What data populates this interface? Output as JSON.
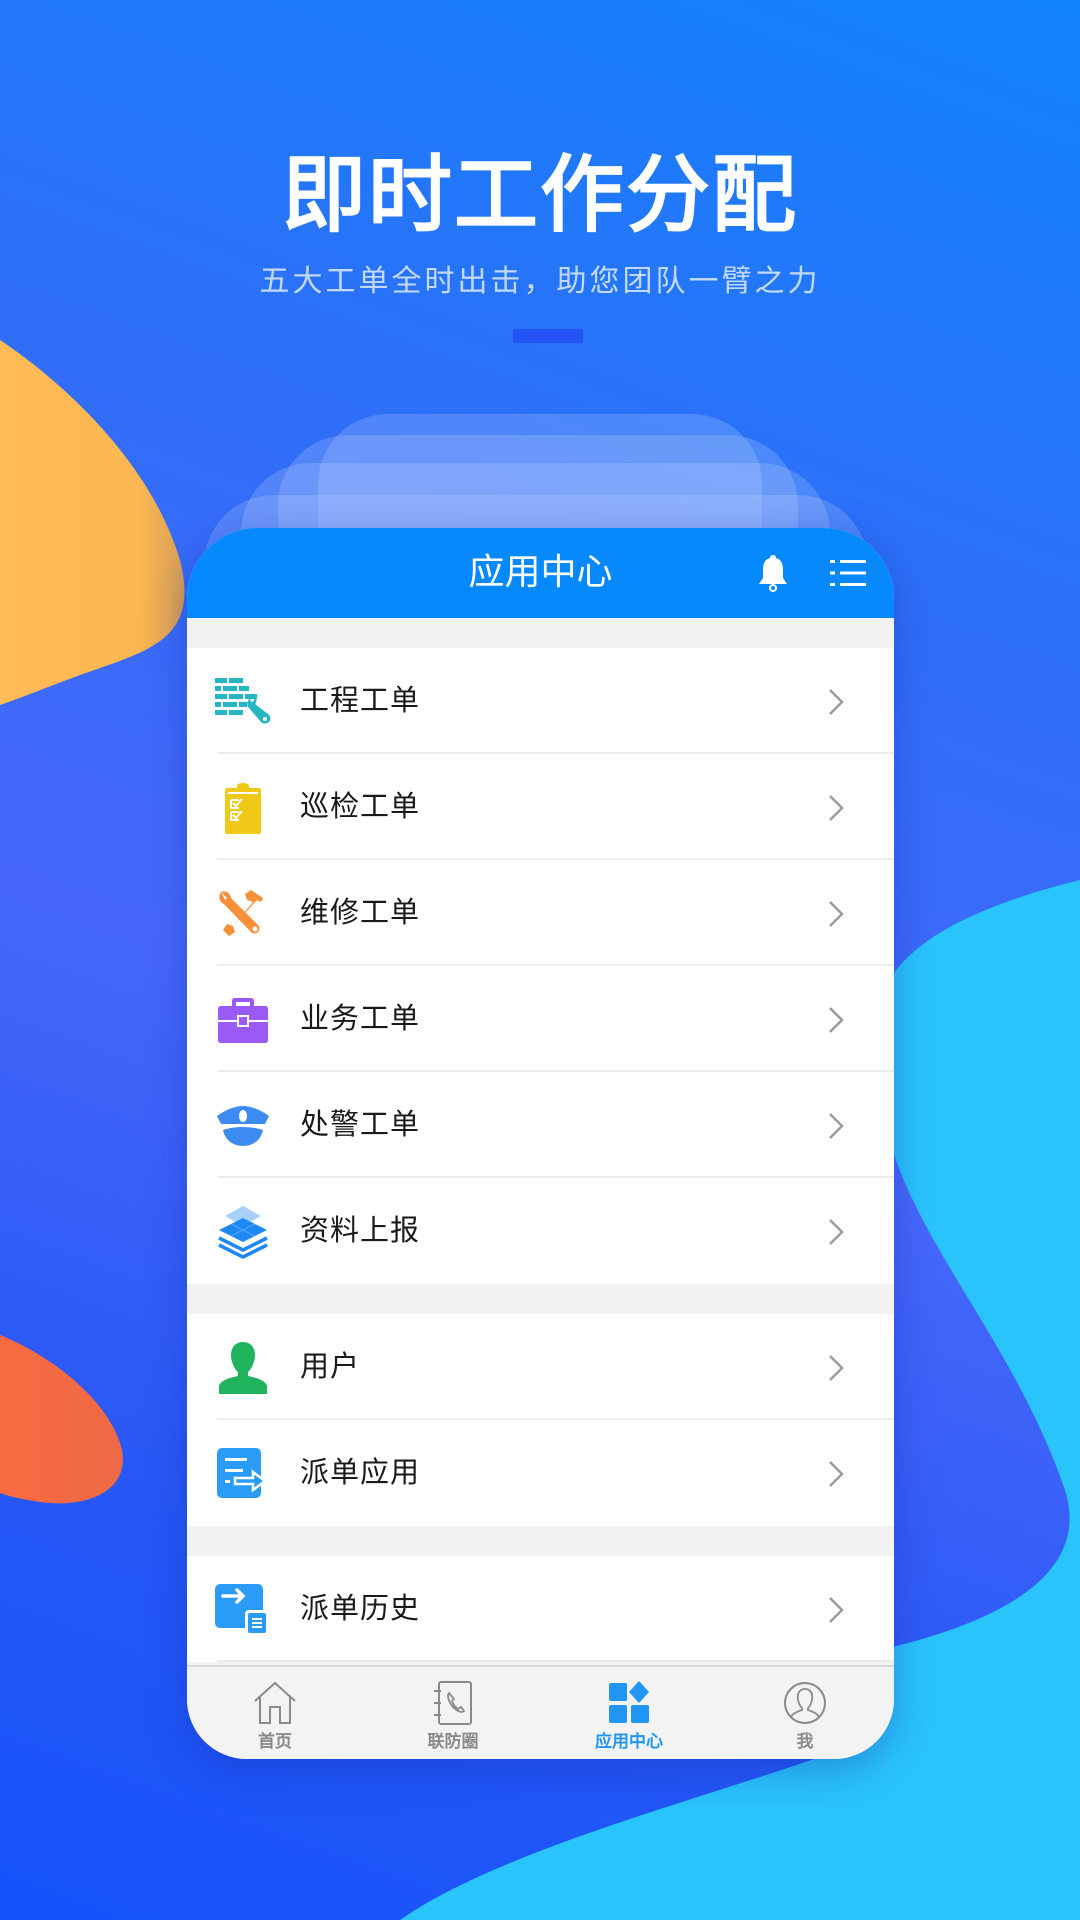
{
  "promo": {
    "headline": "即时工作分配",
    "subline": "五大工单全时出击，助您团队一臂之力"
  },
  "app": {
    "header_title": "应用中心",
    "header_icons": [
      "bell-icon",
      "menu-list-icon"
    ],
    "groups": [
      {
        "items": [
          {
            "label": "工程工单",
            "icon": "engineering-brick-wrench-icon",
            "color": "#26b5c3"
          },
          {
            "label": "巡检工单",
            "icon": "inspection-clipboard-icon",
            "color": "#f0c916"
          },
          {
            "label": "维修工单",
            "icon": "repair-tools-icon",
            "color": "#f6913a"
          },
          {
            "label": "业务工单",
            "icon": "business-briefcase-icon",
            "color": "#9b59f5"
          },
          {
            "label": "处警工单",
            "icon": "police-cap-icon",
            "color": "#3d8bf0"
          },
          {
            "label": "资料上报",
            "icon": "data-layers-icon",
            "color": "#1e88f5"
          }
        ]
      },
      {
        "items": [
          {
            "label": "用户",
            "icon": "user-icon",
            "color": "#1fb35e"
          },
          {
            "label": "派单应用",
            "icon": "dispatch-app-icon",
            "color": "#2a9bf6"
          }
        ]
      },
      {
        "items": [
          {
            "label": "派单历史",
            "icon": "dispatch-history-icon",
            "color": "#2a9bf6"
          }
        ]
      }
    ],
    "tabs": [
      {
        "label": "首页",
        "icon": "home-icon",
        "active": false
      },
      {
        "label": "联防圈",
        "icon": "contact-phone-book-icon",
        "active": false
      },
      {
        "label": "应用中心",
        "icon": "apps-grid-icon",
        "active": true
      },
      {
        "label": "我",
        "icon": "profile-icon",
        "active": false
      }
    ],
    "colors": {
      "header": "#0589fc",
      "tab_active": "#2196f3",
      "tab_inactive": "#8a8a8a"
    }
  }
}
